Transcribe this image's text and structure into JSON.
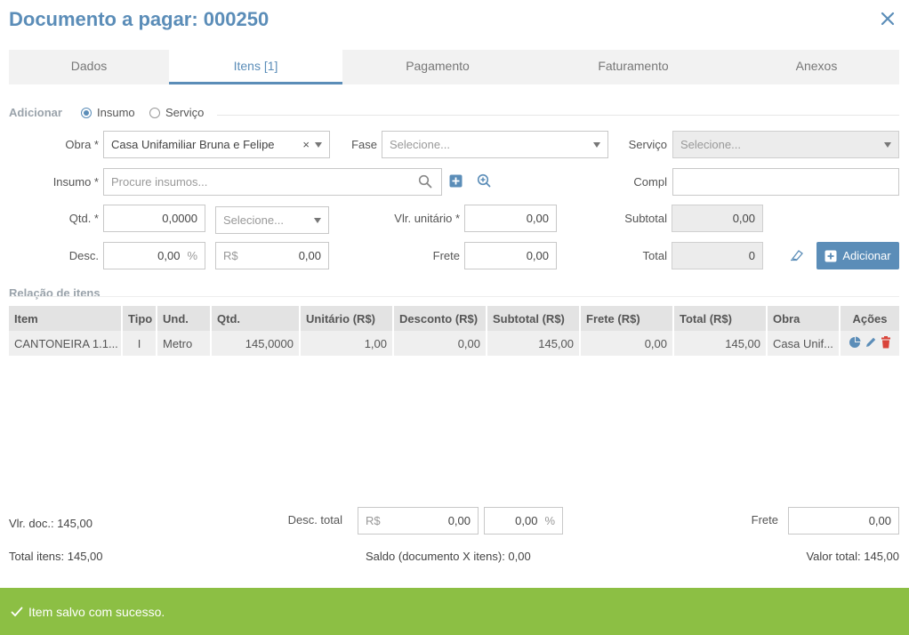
{
  "header": {
    "title": "Documento a pagar: 000250"
  },
  "tabs": [
    {
      "label": "Dados"
    },
    {
      "label": "Itens [1]"
    },
    {
      "label": "Pagamento"
    },
    {
      "label": "Faturamento"
    },
    {
      "label": "Anexos"
    }
  ],
  "add": {
    "section": "Adicionar",
    "radio_insumo": "Insumo",
    "radio_servico": "Serviço",
    "obra_label": "Obra *",
    "obra_value": "Casa Unifamiliar Bruna e Felipe",
    "fase_label": "Fase",
    "fase_placeholder": "Selecione...",
    "servico_label": "Serviço",
    "servico_placeholder": "Selecione...",
    "insumo_label": "Insumo *",
    "insumo_placeholder": "Procure insumos...",
    "compl_label": "Compl",
    "qtd_label": "Qtd. *",
    "qtd_value": "0,0000",
    "unit_placeholder": "Selecione...",
    "vlr_label": "Vlr. unitário *",
    "vlr_value": "0,00",
    "subtotal_label": "Subtotal",
    "subtotal_value": "0,00",
    "desc_label": "Desc.",
    "desc_pct": "0,00",
    "pct_symbol": "%",
    "currency": "R$",
    "desc_value": "0,00",
    "frete_label": "Frete",
    "frete_value": "0,00",
    "total_label": "Total",
    "total_value": "0",
    "add_button": "Adicionar"
  },
  "items": {
    "section": "Relação de itens",
    "columns": [
      "Item",
      "Tipo",
      "Und.",
      "Qtd.",
      "Unitário (R$)",
      "Desconto (R$)",
      "Subtotal (R$)",
      "Frete (R$)",
      "Total (R$)",
      "Obra",
      "Ações"
    ],
    "rows": [
      [
        "CANTONEIRA 1.1...",
        "I",
        "Metro",
        "145,0000",
        "1,00",
        "0,00",
        "145,00",
        "0,00",
        "145,00",
        "Casa Unif..."
      ]
    ]
  },
  "footer": {
    "vlr_doc": "Vlr. doc.: 145,00",
    "desc_total_label": "Desc. total",
    "currency": "R$",
    "desc_total_value": "0,00",
    "desc_total_pct": "0,00",
    "pct_symbol": "%",
    "frete_label": "Frete",
    "frete_value": "0,00",
    "total_itens": "Total itens: 145,00",
    "saldo": "Saldo (documento X itens): 0,00",
    "valor_total": "Valor total: 145,00"
  },
  "toast": {
    "message": "Item salvo com sucesso."
  },
  "colors": {
    "accent": "#5b8db8",
    "success": "#8cbf44",
    "danger": "#d9443a"
  }
}
